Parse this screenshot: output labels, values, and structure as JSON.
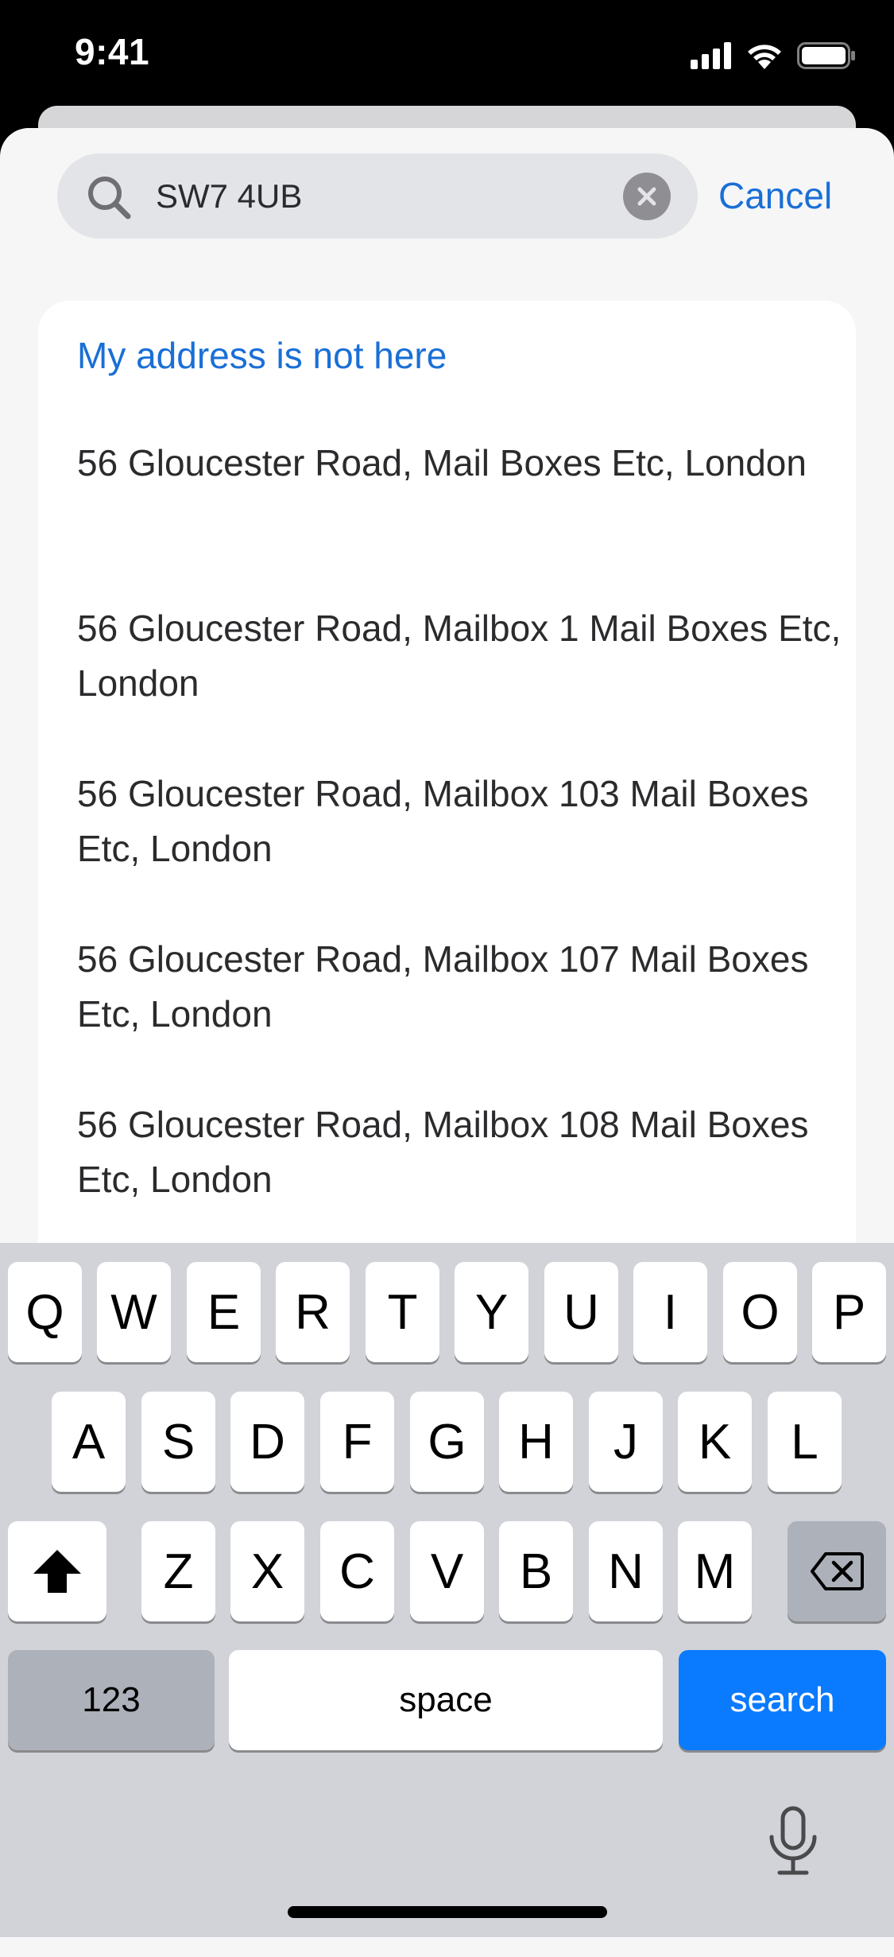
{
  "status_bar": {
    "time": "9:41",
    "icons": [
      "signal-icon",
      "wifi-icon",
      "battery-icon"
    ]
  },
  "search": {
    "value": "SW7 4UB",
    "cancel_label": "Cancel"
  },
  "results": {
    "not_here_label": "My address is not here",
    "items": [
      "56 Gloucester Road, Mail Boxes Etc, London",
      "56 Gloucester Road, Mailbox 1 Mail Boxes Etc, London",
      "56 Gloucester Road, Mailbox 103 Mail Boxes Etc, London",
      "56 Gloucester Road, Mailbox 107 Mail Boxes Etc, London",
      "56 Gloucester Road, Mailbox 108 Mail Boxes Etc, London"
    ]
  },
  "keyboard": {
    "row1": [
      "Q",
      "W",
      "E",
      "R",
      "T",
      "Y",
      "U",
      "I",
      "O",
      "P"
    ],
    "row2": [
      "A",
      "S",
      "D",
      "F",
      "G",
      "H",
      "J",
      "K",
      "L"
    ],
    "row3": [
      "Z",
      "X",
      "C",
      "V",
      "B",
      "N",
      "M"
    ],
    "numbers_label": "123",
    "space_label": "space",
    "search_label": "search"
  },
  "colors": {
    "accent": "#1a6fd6",
    "search_key": "#0a7aff",
    "keyboard_bg": "#d1d3d9"
  }
}
